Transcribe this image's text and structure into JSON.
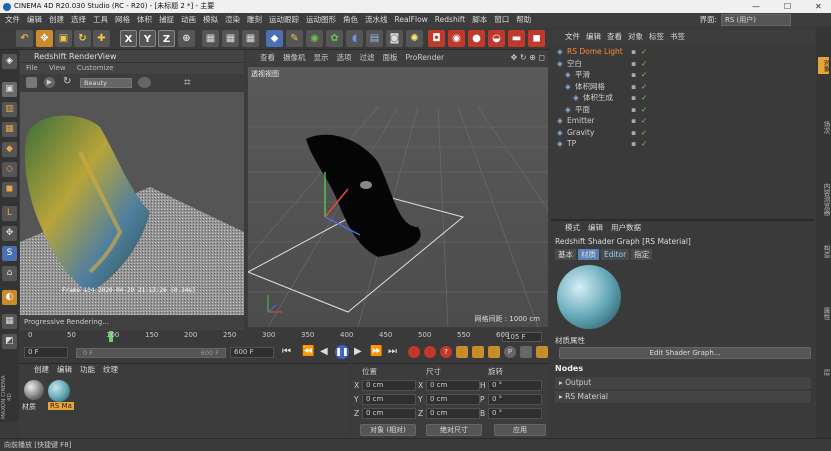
{
  "window": {
    "title": "CINEMA 4D R20.030 Studio (RC - R20) - [未标题 2 *] - 主要",
    "minimize": "—",
    "maximize": "☐",
    "close": "✕"
  },
  "menubar": {
    "items": [
      "文件",
      "编辑",
      "创建",
      "选择",
      "工具",
      "网格",
      "体积",
      "捕捉",
      "动画",
      "模拟",
      "渲染",
      "雕刻",
      "运动跟踪",
      "运动图形",
      "角色",
      "流水线",
      "RealFlow",
      "Redshift",
      "脚本",
      "窗口",
      "帮助"
    ],
    "layout_label": "界面:",
    "layout_value": "RS (用户)"
  },
  "toolbar": {
    "axis_x": "X",
    "axis_y": "Y",
    "axis_z": "Z"
  },
  "renderview": {
    "title": "Redshift RenderView",
    "menu": [
      "File",
      "View",
      "Customize"
    ],
    "aov_select": "Beauty",
    "stamp": "Frame  104   2020-04-29  21:13:26  (0.34s)",
    "status": "Progressive Rendering..."
  },
  "viewport": {
    "menu": [
      "查看",
      "摄像机",
      "显示",
      "选项",
      "过滤",
      "面板",
      "ProRender"
    ],
    "label": "透视视图",
    "grid_info": "网格间距 : 1000 cm"
  },
  "timeline": {
    "ticks": [
      "0",
      "50",
      "100",
      "150",
      "200",
      "250",
      "300",
      "350",
      "400",
      "450",
      "500",
      "550",
      "600"
    ],
    "current_frame": "105 F"
  },
  "transport": {
    "start": "0 F",
    "range_start": "0 F",
    "range_end": "600 F",
    "end": "600 F"
  },
  "material_manager": {
    "menu": [
      "创建",
      "编辑",
      "功能",
      "纹理"
    ],
    "materials": [
      "材质",
      "RS Ma"
    ]
  },
  "coordinates": {
    "headers": [
      "位置",
      "尺寸",
      "旋转"
    ],
    "rows": [
      {
        "p_label": "X",
        "p_val": "0 cm",
        "s_label": "X",
        "s_val": "0 cm",
        "r_label": "H",
        "r_val": "0 °"
      },
      {
        "p_label": "Y",
        "p_val": "0 cm",
        "s_label": "Y",
        "s_val": "0 cm",
        "r_label": "P",
        "r_val": "0 °"
      },
      {
        "p_label": "Z",
        "p_val": "0 cm",
        "s_label": "Z",
        "s_val": "0 cm",
        "r_label": "B",
        "r_val": "0 °"
      }
    ],
    "mode_select": "对象 (相对)",
    "size_select": "绝对尺寸",
    "apply": "应用"
  },
  "object_manager": {
    "menu": [
      "文件",
      "编辑",
      "查看",
      "对象",
      "标签",
      "书签"
    ],
    "objects": [
      {
        "name": "RS Dome Light",
        "indent": 0,
        "color": "#ff8c3a"
      },
      {
        "name": "空白",
        "indent": 0,
        "color": "#cfcfcf"
      },
      {
        "name": "平滑",
        "indent": 1,
        "color": "#cfcfcf"
      },
      {
        "name": "体积网格",
        "indent": 1,
        "color": "#cfcfcf"
      },
      {
        "name": "体积生成",
        "indent": 2,
        "color": "#cfcfcf"
      },
      {
        "name": "平面",
        "indent": 1,
        "color": "#cfcfcf"
      },
      {
        "name": "Emitter",
        "indent": 0,
        "color": "#cfcfcf"
      },
      {
        "name": "Gravity",
        "indent": 0,
        "color": "#cfcfcf"
      },
      {
        "name": "TP",
        "indent": 0,
        "color": "#cfcfcf"
      }
    ]
  },
  "attribute_manager": {
    "menu": [
      "模式",
      "编辑",
      "用户数据"
    ],
    "title": "Redshift Shader Graph [RS Material]",
    "tabs": [
      "基本",
      "材质",
      "Editor",
      "指定"
    ],
    "section": "材质属性",
    "edit_button": "Edit Shader Graph...",
    "nodes_label": "Nodes",
    "output": "Output",
    "rs_material": "RS Material"
  },
  "right_strip": [
    "对象",
    "场次",
    "内容浏览器",
    "构造",
    "属性",
    "层"
  ],
  "left_strip_brand": "MAXON CINEMA 4D",
  "statusbar": "向前播放 [快捷键 F8]"
}
